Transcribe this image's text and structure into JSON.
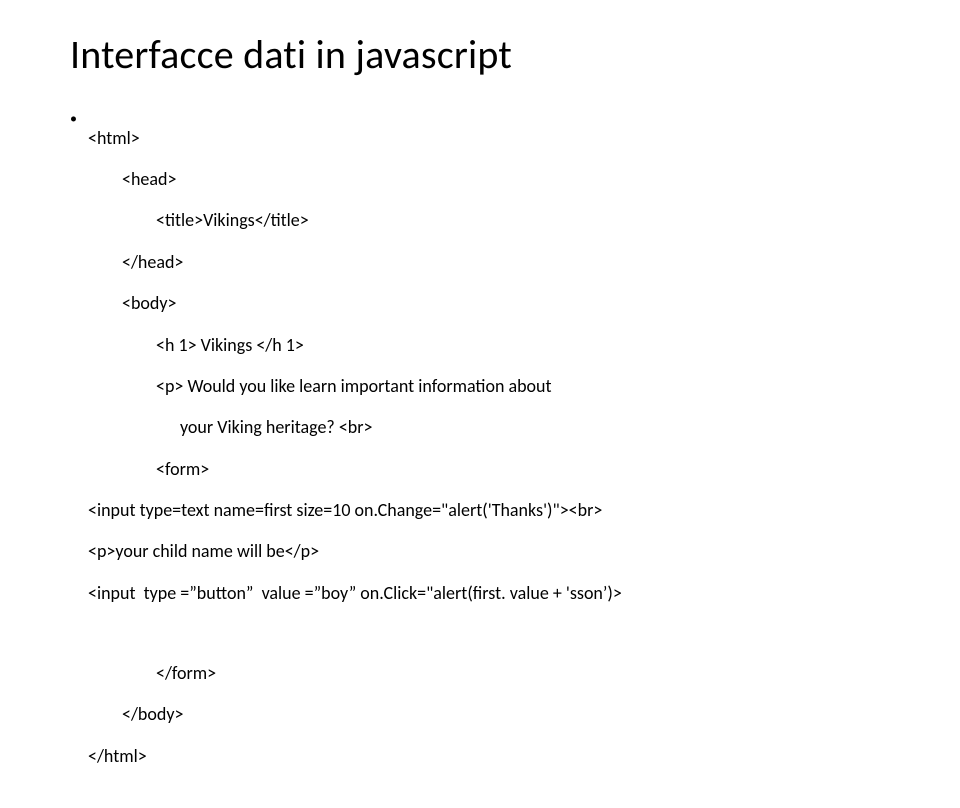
{
  "title": "Interfacce dati in javascript",
  "lines": {
    "l0": "<html>",
    "l1": "<head>",
    "l2": "<title>Vikings</title>",
    "l3": "</head>",
    "l4": "<body>",
    "l5": "<h 1> Vikings </h 1>",
    "l6": "<p> Would you like learn important information about",
    "l7": "your Viking heritage? <br>",
    "l8": "<form>",
    "l9": "<input type=text name=first size=10 on.Change=\"alert('Thanks')\"><br>",
    "l10": "<p>your child name will be</p>",
    "l11": "<input  type =”button”  value =”boy” on.Click=\"alert(first. value + 'sson’)>",
    "l12": "</form>",
    "l13": "</body>",
    "l14": "</html>"
  }
}
